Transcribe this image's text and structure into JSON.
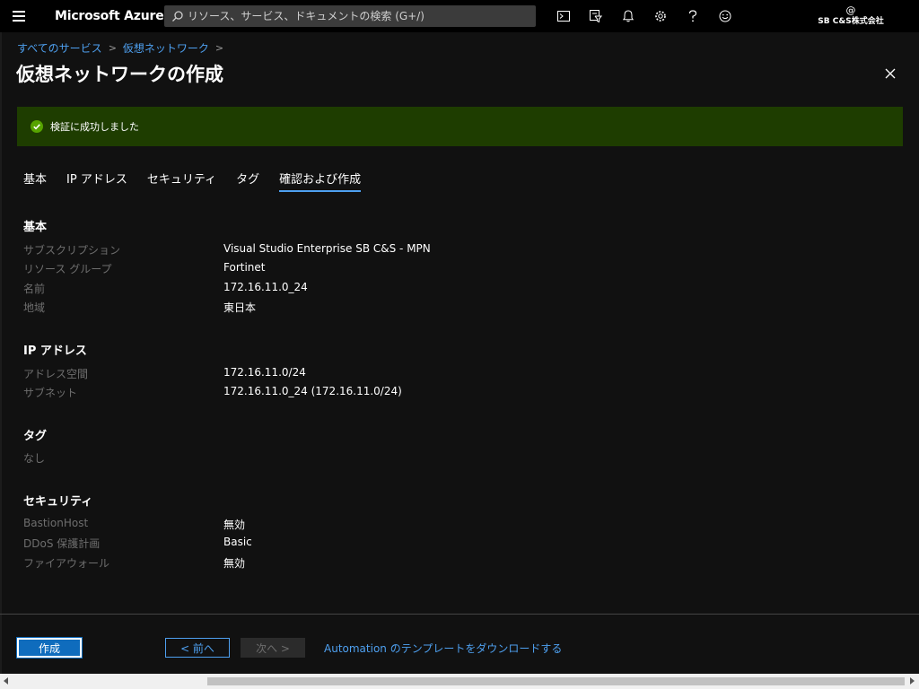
{
  "topbar": {
    "brand": "Microsoft Azure",
    "search_placeholder": "リソース、サービス、ドキュメントの検索 (G+/)",
    "icons": [
      "menu-icon",
      "search-icon",
      "cloud-shell-icon",
      "directory-filter-icon",
      "notifications-icon",
      "settings-icon",
      "help-icon",
      "feedback-icon"
    ],
    "account": {
      "at": "@",
      "company": "SB C&S株式会社"
    }
  },
  "breadcrumb": [
    {
      "label": "すべてのサービス"
    },
    {
      "label": "仮想ネットワーク"
    }
  ],
  "page": {
    "title": "仮想ネットワークの作成"
  },
  "banner": {
    "text": "検証に成功しました",
    "color": "#1e3d00"
  },
  "tabs": [
    {
      "label": "基本"
    },
    {
      "label": "IP アドレス"
    },
    {
      "label": "セキュリティ"
    },
    {
      "label": "タグ"
    },
    {
      "label": "確認および作成",
      "active": true
    }
  ],
  "review": {
    "basics": {
      "heading": "基本",
      "rows": [
        {
          "label": "サブスクリプション",
          "value": "Visual Studio Enterprise SB C&S - MPN"
        },
        {
          "label": "リソース グループ",
          "value": "Fortinet"
        },
        {
          "label": "名前",
          "value": "172.16.11.0_24"
        },
        {
          "label": "地域",
          "value": "東日本"
        }
      ]
    },
    "ip": {
      "heading": "IP アドレス",
      "rows": [
        {
          "label": "アドレス空間",
          "value": "172.16.11.0/24"
        },
        {
          "label": "サブネット",
          "value": "172.16.11.0_24 (172.16.11.0/24)"
        }
      ]
    },
    "tags": {
      "heading": "タグ",
      "none": "なし"
    },
    "security": {
      "heading": "セキュリティ",
      "rows": [
        {
          "label": "BastionHost",
          "value": "無効"
        },
        {
          "label": "DDoS 保護計画",
          "value": "Basic"
        },
        {
          "label": "ファイアウォール",
          "value": "無効"
        }
      ]
    }
  },
  "footer": {
    "create": "作成",
    "prev": "< 前へ",
    "next": "次へ >",
    "download": "Automation のテンプレートをダウンロードする"
  },
  "colors": {
    "accent": "#4ea0f0",
    "primary_button": "#0f6cbd",
    "success": "#57a300"
  }
}
